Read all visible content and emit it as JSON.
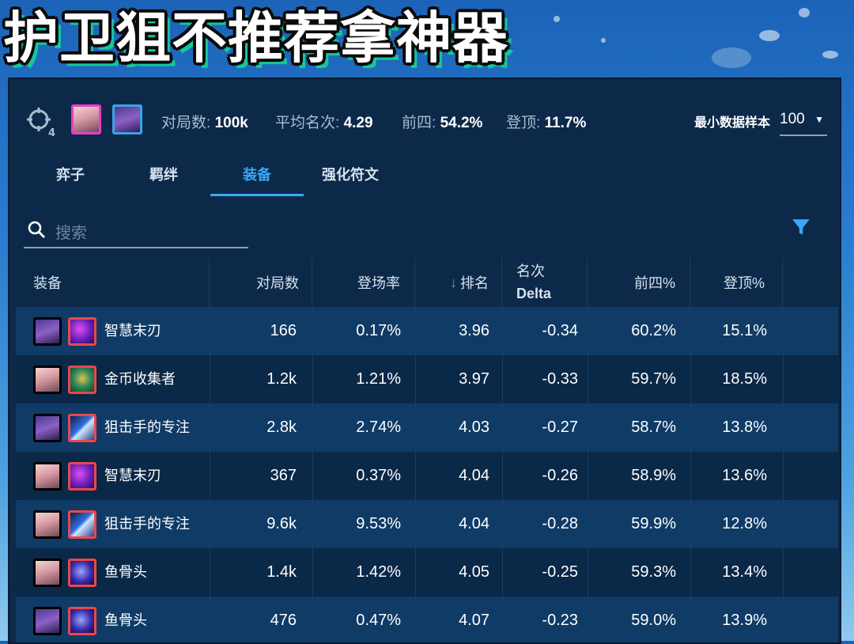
{
  "banner": {
    "title": "护卫狙不推荐拿神器"
  },
  "header": {
    "games_label": "对局数:",
    "games_value": "100k",
    "avg_place_label": "平均名次:",
    "avg_place_value": "4.29",
    "top4_label": "前四:",
    "top4_value": "54.2%",
    "win_label": "登顶:",
    "win_value": "11.7%",
    "min_sample_label": "最小数据样本",
    "min_sample_value": "100"
  },
  "tabs": [
    {
      "label": "弈子",
      "active": false
    },
    {
      "label": "羁绊",
      "active": false
    },
    {
      "label": "装备",
      "active": true
    },
    {
      "label": "强化符文",
      "active": false
    }
  ],
  "search": {
    "placeholder": "搜索"
  },
  "table": {
    "columns": {
      "item": "装备",
      "games": "对局数",
      "pick_rate": "登场率",
      "place": "排名",
      "delta_line1": "名次",
      "delta_line2": "Delta",
      "top4": "前四%",
      "win": "登顶%"
    },
    "sort": {
      "column": "place",
      "direction": "ascending",
      "icon": "arrow-down-icon"
    },
    "rows": [
      {
        "champion": "blue",
        "item_icon": "wisdom-blade",
        "item": "智慧末刃",
        "games": "166",
        "pick_rate": "0.17%",
        "place": "3.96",
        "delta": "-0.34",
        "top4": "60.2%",
        "win": "15.1%"
      },
      {
        "champion": "pink",
        "item_icon": "gold-collector",
        "item": "金币收集者",
        "games": "1.2k",
        "pick_rate": "1.21%",
        "place": "3.97",
        "delta": "-0.33",
        "top4": "59.7%",
        "win": "18.5%"
      },
      {
        "champion": "blue",
        "item_icon": "sniper-focus",
        "item": "狙击手的专注",
        "games": "2.8k",
        "pick_rate": "2.74%",
        "place": "4.03",
        "delta": "-0.27",
        "top4": "58.7%",
        "win": "13.8%"
      },
      {
        "champion": "pink",
        "item_icon": "wisdom-blade",
        "item": "智慧末刃",
        "games": "367",
        "pick_rate": "0.37%",
        "place": "4.04",
        "delta": "-0.26",
        "top4": "58.9%",
        "win": "13.6%"
      },
      {
        "champion": "pink",
        "item_icon": "sniper-focus",
        "item": "狙击手的专注",
        "games": "9.6k",
        "pick_rate": "9.53%",
        "place": "4.04",
        "delta": "-0.28",
        "top4": "59.9%",
        "win": "12.8%"
      },
      {
        "champion": "pink",
        "item_icon": "fish-bones",
        "item": "鱼骨头",
        "games": "1.4k",
        "pick_rate": "1.42%",
        "place": "4.05",
        "delta": "-0.25",
        "top4": "59.3%",
        "win": "13.4%"
      },
      {
        "champion": "blue",
        "item_icon": "fish-bones",
        "item": "鱼骨头",
        "games": "476",
        "pick_rate": "0.47%",
        "place": "4.07",
        "delta": "-0.23",
        "top4": "59.0%",
        "win": "13.9%"
      }
    ]
  },
  "colors": {
    "panel_bg": "#0c2949",
    "row_odd": "#0f3b66",
    "row_even": "#0a2847",
    "accent": "#3aa8f5",
    "banner_shadow": "#14c79a"
  }
}
